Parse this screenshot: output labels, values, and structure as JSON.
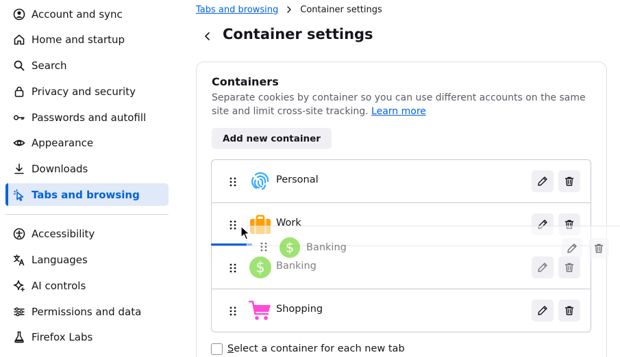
{
  "sidebar": {
    "items": [
      {
        "label": "Account and sync",
        "icon": "account-icon"
      },
      {
        "label": "Home and startup",
        "icon": "home-icon"
      },
      {
        "label": "Search",
        "icon": "search-icon"
      },
      {
        "label": "Privacy and security",
        "icon": "lock-icon"
      },
      {
        "label": "Passwords and autofill",
        "icon": "key-icon"
      },
      {
        "label": "Appearance",
        "icon": "eye-icon"
      },
      {
        "label": "Downloads",
        "icon": "download-icon"
      },
      {
        "label": "Tabs and browsing",
        "icon": "cursor-click-icon",
        "selected": true
      },
      {
        "label": "Accessibility",
        "icon": "accessibility-icon"
      },
      {
        "label": "Languages",
        "icon": "languages-icon"
      },
      {
        "label": "AI controls",
        "icon": "sparkle-icon"
      },
      {
        "label": "Permissions and data",
        "icon": "sliders-icon"
      },
      {
        "label": "Firefox Labs",
        "icon": "flask-icon"
      }
    ]
  },
  "breadcrumb": {
    "parent": "Tabs and browsing",
    "current": "Container settings"
  },
  "page": {
    "title": "Container settings"
  },
  "containers": {
    "title": "Containers",
    "description": "Separate cookies by container so you can use different accounts on the same site and limit cross-site tracking.",
    "learn_more": "Learn more",
    "add_button": "Add new container",
    "items": [
      {
        "name": "Personal",
        "icon": "fingerprint-icon",
        "color": "#37adff"
      },
      {
        "name": "Work",
        "icon": "briefcase-icon",
        "color": "#ff9f00"
      },
      {
        "name": "Banking",
        "icon": "dollar-icon",
        "color": "#51cd00"
      },
      {
        "name": "Shopping",
        "icon": "cart-icon",
        "color": "#ff4bda"
      }
    ],
    "dragging": {
      "name": "Banking",
      "icon": "dollar-icon",
      "color": "#51cd00"
    }
  },
  "options": {
    "select_container": {
      "accesskey": "S",
      "label_rest": "elect a container for each new tab",
      "checked": false
    }
  },
  "colors": {
    "accent": "#0061e0",
    "selected_bg": "#e0e9f7"
  }
}
